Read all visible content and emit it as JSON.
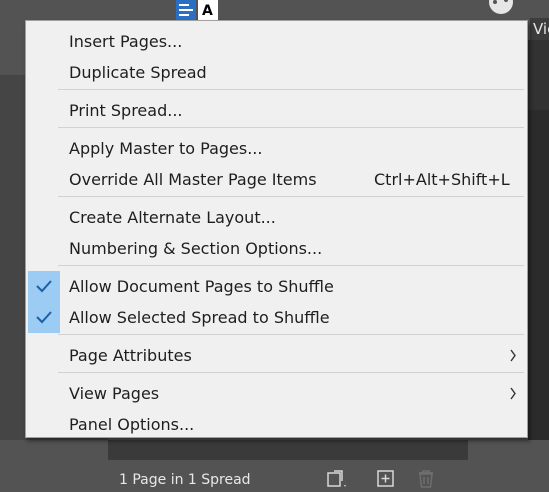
{
  "panel_tab": {
    "label": "Vie"
  },
  "menu": {
    "items": [
      {
        "label": "Insert Pages..."
      },
      {
        "label": "Duplicate Spread"
      },
      {
        "label": "Print Spread..."
      },
      {
        "label": "Apply Master to Pages..."
      },
      {
        "label": "Override All Master Page Items",
        "shortcut": "Ctrl+Alt+Shift+L"
      },
      {
        "label": "Create Alternate Layout..."
      },
      {
        "label": "Numbering & Section Options..."
      },
      {
        "label": "Allow Document Pages to Shuffle",
        "checked": true
      },
      {
        "label": "Allow Selected Spread to Shuffle",
        "checked": true
      },
      {
        "label": "Page Attributes",
        "submenu": true
      },
      {
        "label": "View Pages",
        "submenu": true
      },
      {
        "label": "Panel Options..."
      }
    ]
  },
  "status": {
    "text": "1 Page in 1 Spread"
  },
  "icons": {
    "master": "master-page-icon",
    "palette": "palette-icon",
    "edit_page_size": "edit-page-size-icon",
    "new_page": "new-page-icon",
    "delete": "trash-icon"
  },
  "colors": {
    "menu_bg": "#f0f0f0",
    "check_highlight": "#9ccbf4",
    "check_mark": "#1a5fa8",
    "panel_bg": "#535353"
  }
}
